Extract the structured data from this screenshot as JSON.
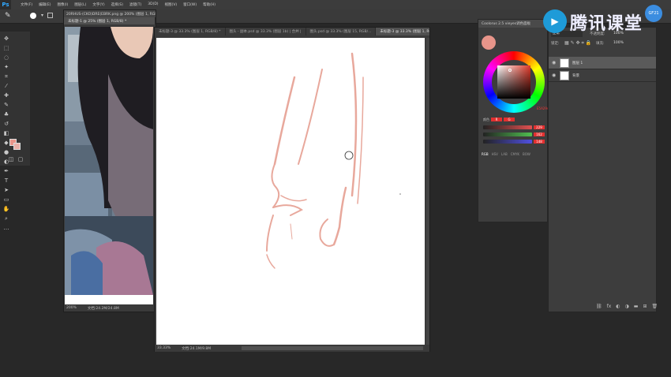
{
  "app": {
    "logo": "Ps"
  },
  "menu": [
    "文件(F)",
    "编辑(E)",
    "图像(I)",
    "图层(L)",
    "文字(Y)",
    "选择(S)",
    "滤镜(T)",
    "3D(D)",
    "视图(V)",
    "窗口(W)",
    "帮助(H)"
  ],
  "watermark": {
    "text": "腾讯课堂",
    "badge": "GF21"
  },
  "doc1": {
    "title": "20RHUS-(CKO)DRE(EBRK.png @ 200% (图层 1, RGB/8#) *",
    "tab": "未标题-1 @ 25% (图层 1, RGB/8) *",
    "zoom": "200%",
    "status": "文档:24.2M/24.8M"
  },
  "doc2": {
    "tabs": [
      "未标题-3 @ 33.3% (图层 1, RGB/8) *",
      "图头 - 副本.psd @ 33.3% (图层 1b) | 合并 |",
      "图头.psd @ 33.3% (图层 15, RGB/...",
      "未标题-3 @ 33.3% (图层 1, RGB/8) *"
    ],
    "zoom": "33.33%",
    "status": "文档:24.1M/9.8M"
  },
  "color_panel": {
    "title": "Coolorus 2.5 vieyes调色面板",
    "swatch": "#e8958a",
    "mode_tabs": [
      "RGB",
      "HSV",
      "LAB",
      "CMYK",
      "BOW"
    ],
    "sliders": [
      {
        "label": "R",
        "value": "229",
        "color": "#e05050"
      },
      {
        "label": "G",
        "value": "162",
        "color": "#50c050"
      },
      {
        "label": "B",
        "value": "148",
        "color": "#5050e0"
      }
    ],
    "chips": [
      "R",
      "G",
      "B"
    ],
    "hex": "E5A294"
  },
  "layers_panel": {
    "blend_mode": "正常",
    "opacity_label": "不透明度:",
    "opacity": "100%",
    "lock_label": "锁定:",
    "fill_label": "填充:",
    "fill": "100%",
    "layers": [
      {
        "name": "图层 1",
        "selected": true
      },
      {
        "name": "背景",
        "selected": false
      }
    ],
    "footer_icons": [
      "link-icon",
      "fx-icon",
      "mask-icon",
      "adjustment-icon",
      "group-icon",
      "new-layer-icon",
      "trash-icon"
    ]
  },
  "foreground_color": "#e8958a",
  "background_color": "#e8b0a8"
}
